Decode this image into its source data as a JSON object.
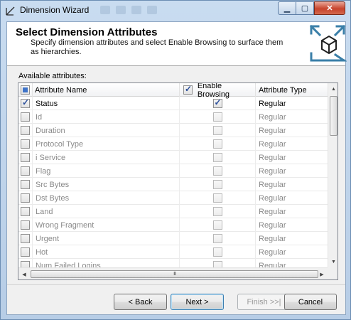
{
  "window": {
    "title": "Dimension Wizard",
    "close_label": "✕",
    "min_label": "▁",
    "max_label": "▢"
  },
  "header": {
    "title": "Select Dimension Attributes",
    "description": "Specify dimension attributes and select Enable Browsing to surface them as hierarchies."
  },
  "grid": {
    "label": "Available attributes:",
    "columns": {
      "name": "Attribute Name",
      "browsing": "Enable Browsing",
      "type": "Attribute Type"
    },
    "rows": [
      {
        "name": "Status",
        "selected": true,
        "browsing": true,
        "type": "Regular"
      },
      {
        "name": "Id",
        "selected": false,
        "browsing": false,
        "type": "Regular"
      },
      {
        "name": "Duration",
        "selected": false,
        "browsing": false,
        "type": "Regular"
      },
      {
        "name": "Protocol Type",
        "selected": false,
        "browsing": false,
        "type": "Regular"
      },
      {
        "name": "i Service",
        "selected": false,
        "browsing": false,
        "type": "Regular"
      },
      {
        "name": "Flag",
        "selected": false,
        "browsing": false,
        "type": "Regular"
      },
      {
        "name": "Src Bytes",
        "selected": false,
        "browsing": false,
        "type": "Regular"
      },
      {
        "name": "Dst Bytes",
        "selected": false,
        "browsing": false,
        "type": "Regular"
      },
      {
        "name": "Land",
        "selected": false,
        "browsing": false,
        "type": "Regular"
      },
      {
        "name": "Wrong Fragment",
        "selected": false,
        "browsing": false,
        "type": "Regular"
      },
      {
        "name": "Urgent",
        "selected": false,
        "browsing": false,
        "type": "Regular"
      },
      {
        "name": "Hot",
        "selected": false,
        "browsing": false,
        "type": "Regular"
      },
      {
        "name": "Num Failed Logins",
        "selected": false,
        "browsing": false,
        "type": "Regular"
      }
    ],
    "hscroll_grip": "III"
  },
  "buttons": {
    "back": "< Back",
    "next": "Next >",
    "finish": "Finish >>|",
    "cancel": "Cancel"
  },
  "colors": {
    "titlebar": "#c9dcf0",
    "close": "#c7432c",
    "accent": "#3c7fb1"
  }
}
